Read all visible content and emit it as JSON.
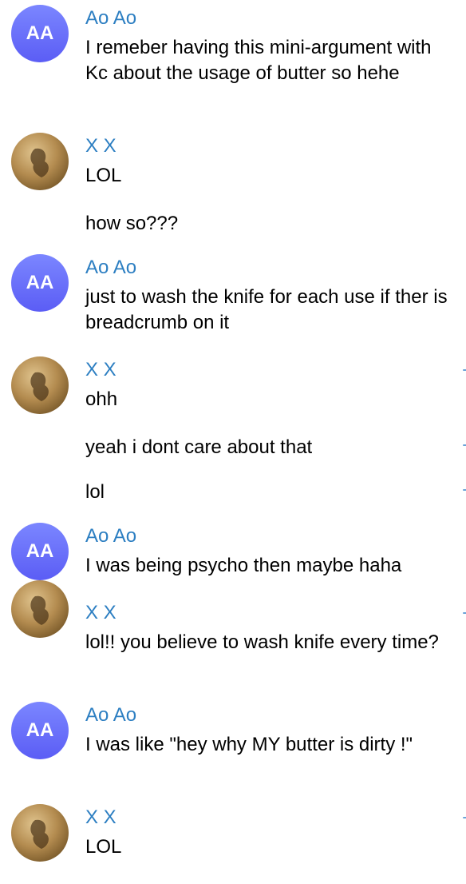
{
  "messages": [
    {
      "sender": "Ao Ao",
      "avatar": "AA",
      "lines": [
        "I remeber having this mini-argument with Kc about the usage of butter so hehe"
      ]
    },
    {
      "sender": "X X",
      "avatar": "photo",
      "lines": [
        "LOL",
        "how so???"
      ]
    },
    {
      "sender": "Ao Ao",
      "avatar": "AA",
      "lines": [
        "just to wash the knife for each use if ther is breadcrumb on it"
      ]
    },
    {
      "sender": "X X",
      "avatar": "photo",
      "lines": [
        "ohh",
        "yeah i dont care about that",
        "lol"
      ]
    },
    {
      "sender": "Ao Ao",
      "avatar": "AA",
      "lines": [
        "I was being psycho then maybe haha"
      ]
    },
    {
      "sender": "X X",
      "avatar": "photo",
      "lines": [
        "lol!! you believe to wash knife every time?"
      ]
    },
    {
      "sender": "Ao Ao",
      "avatar": "AA",
      "lines": [
        "I was like \"hey why MY butter is dirty !\""
      ]
    },
    {
      "sender": "X X",
      "avatar": "photo",
      "lines": [
        "LOL"
      ]
    }
  ],
  "colors": {
    "sender": "#2d7fc2",
    "avatar_aa": "#6a70fa"
  }
}
